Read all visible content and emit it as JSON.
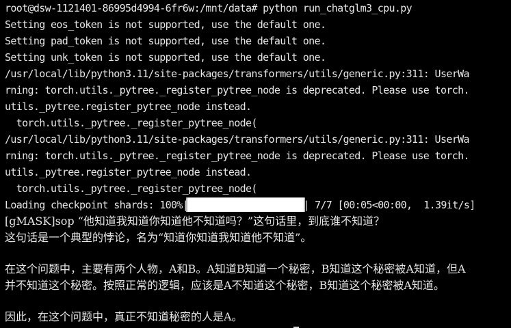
{
  "terminal": {
    "lines": [
      "root@dsw-1121401-86995d4994-6fr6w:/mnt/data# python run_chatglm3_cpu.py",
      "Setting eos_token is not supported, use the default one.",
      "Setting pad_token is not supported, use the default one.",
      "Setting unk_token is not supported, use the default one.",
      "/usr/local/lib/python3.11/site-packages/transformers/utils/generic.py:311: UserWa",
      "rning: torch.utils._pytree._register_pytree_node is deprecated. Please use torch.",
      "utils._pytree.register_pytree_node instead.",
      "  torch.utils._pytree._register_pytree_node(",
      "/usr/local/lib/python3.11/site-packages/transformers/utils/generic.py:311: UserWa",
      "rning: torch.utils._pytree._register_pytree_node is deprecated. Please use torch.",
      "utils._pytree.register_pytree_node instead.",
      "  torch.utils._pytree._register_pytree_node("
    ],
    "progress": {
      "prefix": "Loading checkpoint shards: 100%|",
      "suffix": "| 7/7 [00:05<00:00,  1.39it/s]",
      "fraction": 1.0
    },
    "output": [
      "[gMASK]sop “他知道我知道你知道他不知道吗？”这句话里，到底谁不知道？",
      "这句话是一个典型的悖论，名为“知道你知道我知道他不知道”。",
      "",
      "在这个问题中，主要有两个人物，A和B。A知道B知道一个秘密，B知道这个秘密被A知道，但A",
      "并不知道这个秘密。按照正常的逻辑，应该是A不知道这个秘密，B知道这个秘密被A知道。",
      "",
      "因此，在这个问题中，真正不知道秘密的人是A。"
    ],
    "colors": {
      "background": "#000000",
      "text": "#e6e6e6",
      "progress_fill": "#ffffff"
    }
  }
}
